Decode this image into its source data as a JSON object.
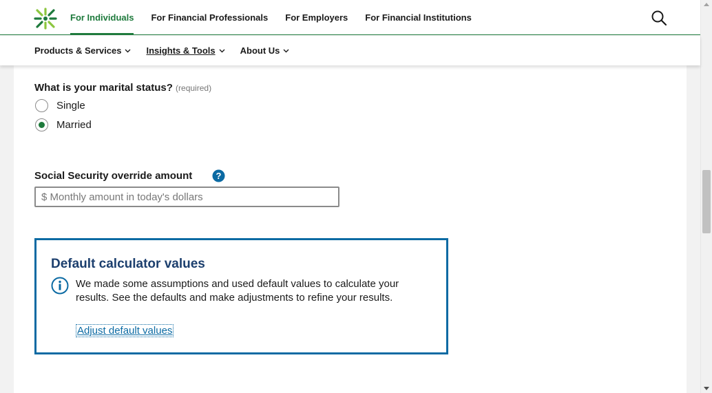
{
  "header": {
    "audience_tabs": [
      {
        "label": "For Individuals",
        "active": true
      },
      {
        "label": "For Financial Professionals",
        "active": false
      },
      {
        "label": "For Employers",
        "active": false
      },
      {
        "label": "For Financial Institutions",
        "active": false
      }
    ],
    "search_icon": "search-icon",
    "logo_icon": "brand-logo-icon"
  },
  "subnav": {
    "items": [
      {
        "label": "Products & Services",
        "icon": "chevron-down-icon"
      },
      {
        "label": "Insights & Tools",
        "icon": "chevron-down-icon"
      },
      {
        "label": "About Us",
        "icon": "chevron-down-icon"
      }
    ]
  },
  "form": {
    "marital_question": "What is your marital status?",
    "required_note": "(required)",
    "marital_options": [
      {
        "label": "Single",
        "checked": false
      },
      {
        "label": "Married",
        "checked": true
      }
    ],
    "ss_override_label": "Social Security override amount",
    "ss_override_placeholder": "$ Monthly amount in today's dollars",
    "ss_override_value": ""
  },
  "defaults_panel": {
    "title": "Default calculator values",
    "body": "We made some assumptions and used default values to calculate your results. See the defaults and make adjustments to refine your results.",
    "link_label": "Adjust default values",
    "icon": "info-icon"
  },
  "colors": {
    "brand_green": "#1e7a3c",
    "link_blue": "#0b6aa3",
    "heading_navy": "#1c3f6e"
  }
}
